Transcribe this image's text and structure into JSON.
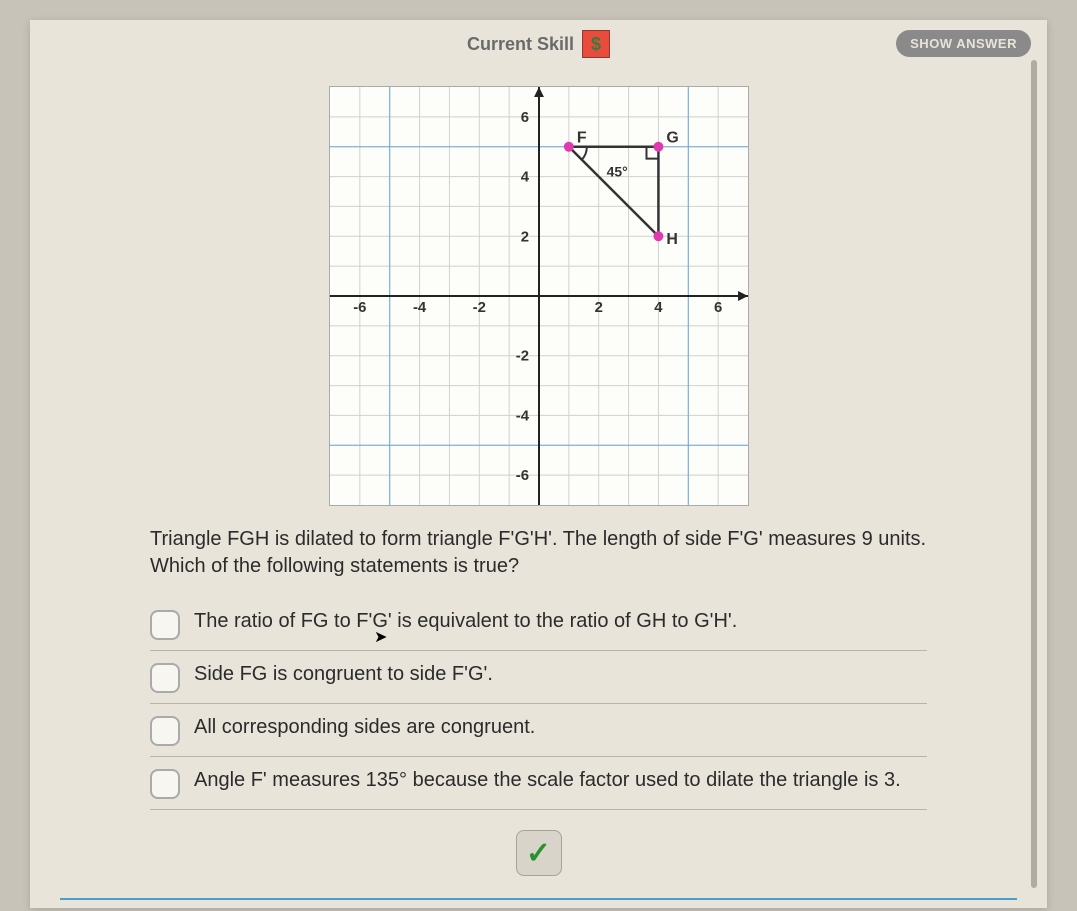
{
  "header": {
    "current_skill_label": "Current Skill",
    "skill_badge": "$",
    "show_answer_label": "SHOW ANSWER"
  },
  "chart_data": {
    "type": "scatter",
    "title": "",
    "xlabel": "",
    "ylabel": "",
    "xlim": [
      -7,
      7
    ],
    "ylim": [
      -7,
      7
    ],
    "xticks": [
      -6,
      -4,
      -2,
      2,
      4,
      6
    ],
    "yticks": [
      -6,
      -4,
      -2,
      2,
      4,
      6
    ],
    "points": [
      {
        "label": "F",
        "x": 1,
        "y": 5
      },
      {
        "label": "G",
        "x": 4,
        "y": 5
      },
      {
        "label": "H",
        "x": 4,
        "y": 2
      }
    ],
    "segments": [
      {
        "from": "F",
        "to": "G"
      },
      {
        "from": "G",
        "to": "H"
      },
      {
        "from": "F",
        "to": "H"
      }
    ],
    "angle_labels": [
      {
        "at": "G",
        "text": "45°",
        "right_angle_marker": true
      }
    ]
  },
  "question": "Triangle FGH is dilated to form triangle F'G'H'. The length of side F'G' measures 9 units. Which of the following statements is true?",
  "options": [
    "The ratio of FG to F'G' is equivalent to the ratio of GH to G'H'.",
    "Side FG is congruent to side F'G'.",
    "All corresponding sides are congruent.",
    "Angle F' measures 135° because the scale factor used to dilate the triangle is 3."
  ],
  "footer": ""
}
